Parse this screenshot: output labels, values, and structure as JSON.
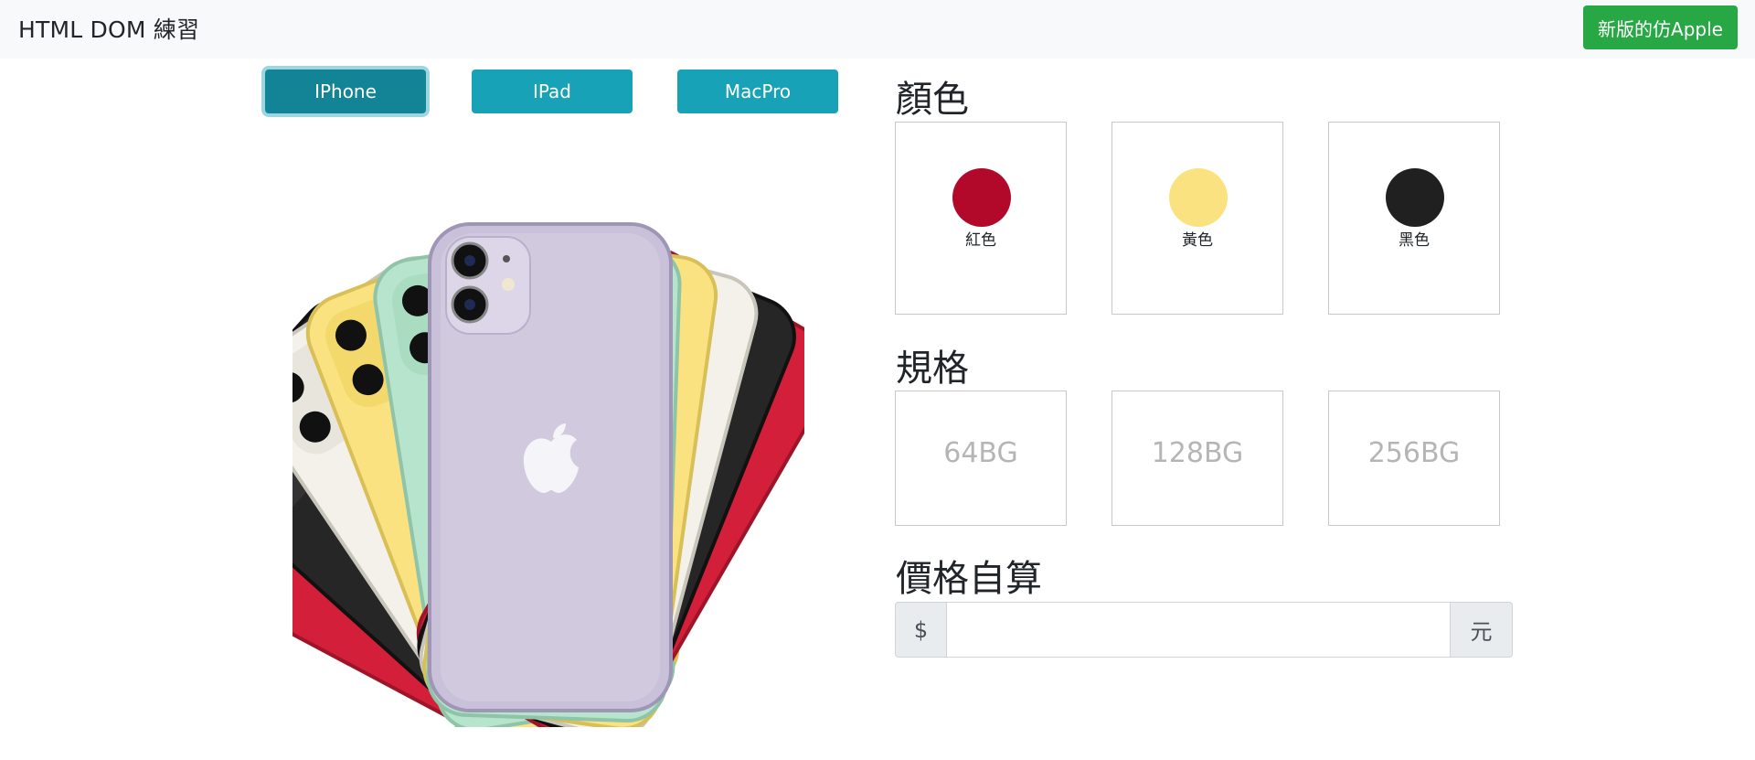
{
  "navbar": {
    "brand": "HTML DOM 練習",
    "new_version_button": "新版的仿Apple",
    "new_version_color": "#28a745"
  },
  "product_tabs": [
    {
      "label": "IPhone",
      "active": true
    },
    {
      "label": "IPad",
      "active": false
    },
    {
      "label": "MacPro",
      "active": false
    }
  ],
  "tab_color": "#17a2b8",
  "color_section": {
    "title": "顏色",
    "options": [
      {
        "label": "紅色",
        "swatch": "#b2092b"
      },
      {
        "label": "黃色",
        "swatch": "#f9e27f"
      },
      {
        "label": "黑色",
        "swatch": "#202020"
      }
    ]
  },
  "spec_section": {
    "title": "規格",
    "options": [
      {
        "label": "64BG"
      },
      {
        "label": "128BG"
      },
      {
        "label": "256BG"
      }
    ]
  },
  "price_section": {
    "title": "價格自算",
    "prefix": "$",
    "suffix": "元",
    "value": ""
  },
  "product_image": {
    "icon": "iphone-11-fan-image",
    "phone_colors": [
      "#c7bfd6",
      "#b7e4cc",
      "#f9e27f",
      "#f3f1ea",
      "#232323",
      "#d41f3a"
    ]
  }
}
